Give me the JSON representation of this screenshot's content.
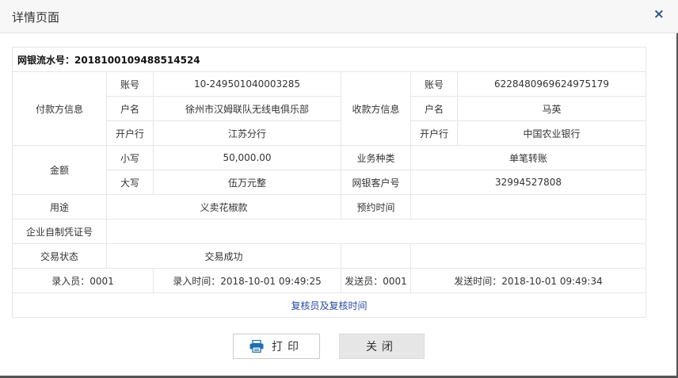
{
  "dialog": {
    "title": "详情页面",
    "close_glyph": "×"
  },
  "serial": {
    "label_value": "网银流水号：2018100109488514524"
  },
  "payer": {
    "group_label": "付款方信息",
    "account_label": "账号",
    "account": "10-249501040003285",
    "name_label": "户名",
    "name": "徐州市汉姆联队无线电俱乐部",
    "bank_label": "开户行",
    "bank": "江苏分行"
  },
  "payee": {
    "group_label": "收款方信息",
    "account_label": "账号",
    "account": "6228480969624975179",
    "name_label": "户名",
    "name": "马英",
    "bank_label": "开户行",
    "bank": "中国农业银行"
  },
  "amount": {
    "group_label": "金额",
    "small_label": "小写",
    "small": "50,000.00",
    "big_label": "大写",
    "big": "伍万元整"
  },
  "business": {
    "type_label": "业务种类",
    "type": "单笔转账",
    "customer_no_label": "网银客户号",
    "customer_no": "32994527808"
  },
  "purpose": {
    "label": "用途",
    "value": "义卖花椒款",
    "appointment_label": "预约时间",
    "appointment": ""
  },
  "voucher": {
    "label": "企业自制凭证号",
    "value": ""
  },
  "status": {
    "label": "交易状态",
    "value": "交易成功"
  },
  "footer_row": {
    "entry_clerk": "录入员：0001",
    "entry_time": "录入时间：2018-10-01 09:49:25",
    "sender": "发送员：0001",
    "send_time": "发送时间：2018-10-01 09:49:34"
  },
  "review": {
    "link_label": "复核员及复核时间"
  },
  "buttons": {
    "print_label": "打印",
    "close_label": "关闭"
  },
  "colors": {
    "border": "#e6e6e6",
    "link": "#2b4aa6",
    "print_icon": "#1f6fb2"
  }
}
